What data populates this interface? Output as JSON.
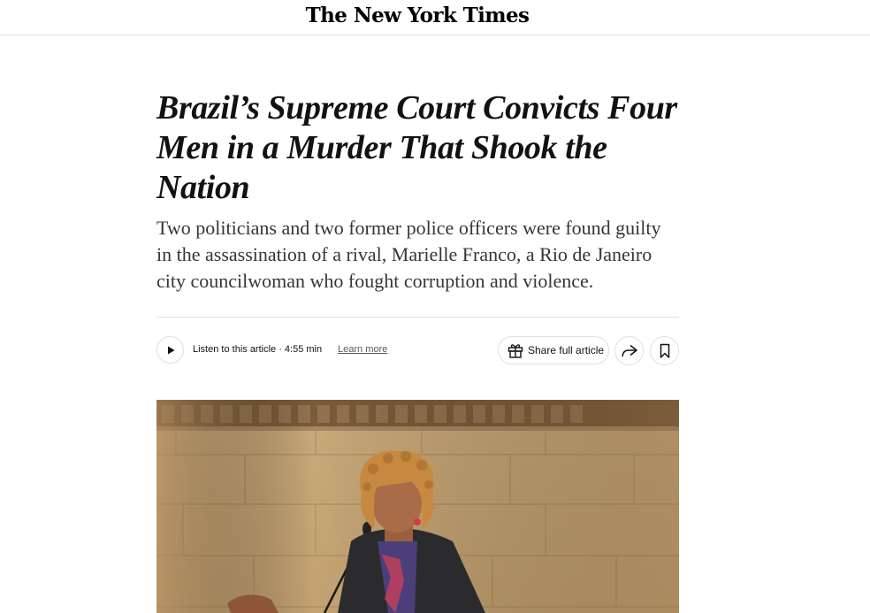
{
  "masthead": {
    "logo_text": "The New York Times"
  },
  "article": {
    "headline": "Brazil’s Supreme Court Convicts Four Men in a Murder That Shook the Nation",
    "summary": "Two politicians and two former police officers were found guilty in the assassination of a rival, Marielle Franco, a Rio de Janeiro city councilwoman who fought corruption and violence."
  },
  "toolbar": {
    "listen_label": "Listen to this article · 4:55 min",
    "learn_more": "Learn more",
    "share_full_article": "Share full article",
    "icons": {
      "play": "play-icon",
      "gift": "gift-icon",
      "share": "share-arrow-icon",
      "bookmark": "bookmark-icon"
    }
  },
  "photo": {
    "subject": "woman-speaking-at-podium"
  },
  "colors": {
    "text": "#121212",
    "summary_text": "#363636",
    "divider": "#dfdfdf",
    "muted": "#5a5a5a"
  }
}
